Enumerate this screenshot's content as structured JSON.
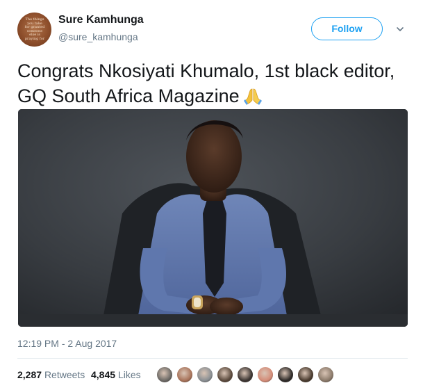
{
  "user": {
    "name": "Sure Kamhunga",
    "handle": "@sure_kamhunga",
    "avatar_text": "The things\nyou take\nfor granted\nsomeone\nelse is\npraying for"
  },
  "follow_label": "Follow",
  "tweet": {
    "text": "Congrats Nkosiyati Khumalo, 1st black editor, GQ South Africa Magazine",
    "emoji": "folded-hands",
    "timestamp": "12:19 PM - 2 Aug 2017"
  },
  "stats": {
    "retweets_count": "2,287",
    "retweets_label": "Retweets",
    "likes_count": "4,845",
    "likes_label": "Likes"
  },
  "likers": [
    {
      "color": "#6d6a66"
    },
    {
      "color": "#a8735a"
    },
    {
      "color": "#8a8f93"
    },
    {
      "color": "#5b4a3d"
    },
    {
      "color": "#3c3532"
    },
    {
      "color": "#d48c78"
    },
    {
      "color": "#2e2a28"
    },
    {
      "color": "#4a3b2f"
    },
    {
      "color": "#8b7a6a"
    },
    {
      "color": "#b7a7a2"
    }
  ],
  "colors": {
    "accent": "#1da1f2",
    "secondary_text": "#657786",
    "primary_text": "#14171a"
  }
}
